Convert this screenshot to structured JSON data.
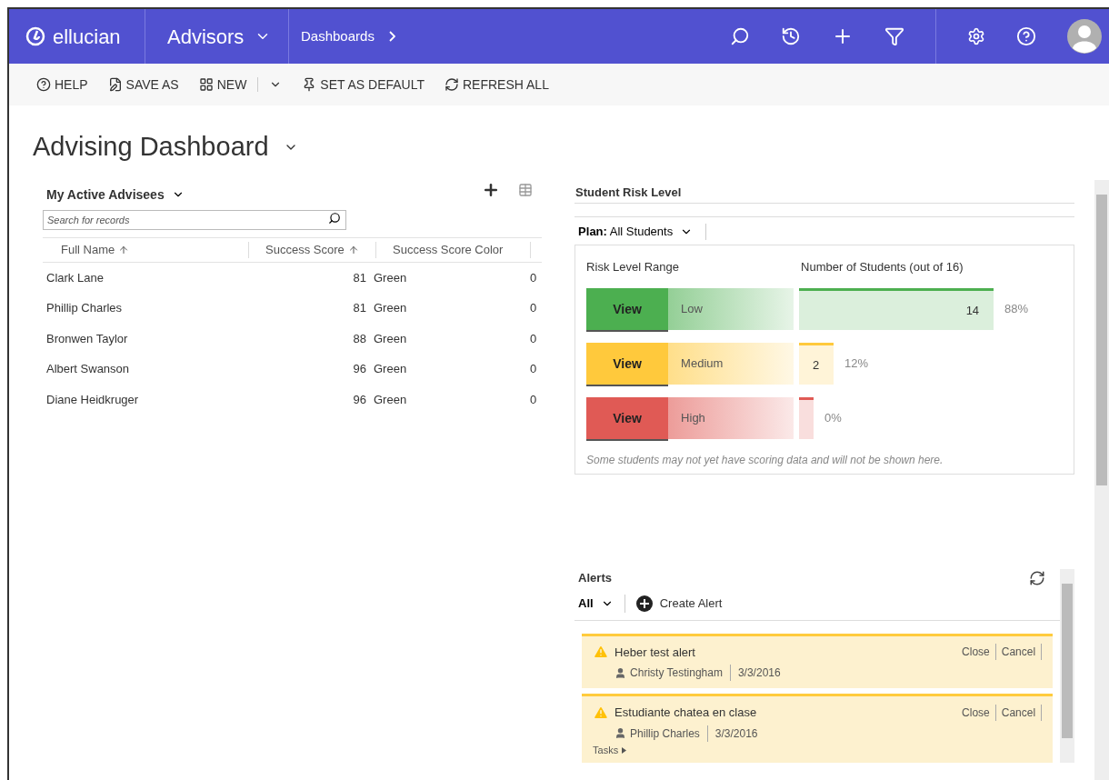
{
  "nav": {
    "brand": "ellucian",
    "module": "Advisors",
    "breadcrumb": "Dashboards"
  },
  "toolbar": [
    {
      "label": "HELP",
      "kind": "button"
    },
    {
      "label": "SAVE AS",
      "kind": "button"
    },
    {
      "label": "NEW",
      "kind": "split"
    },
    {
      "label": "SET AS DEFAULT",
      "kind": "button"
    },
    {
      "label": "REFRESH ALL",
      "kind": "button"
    }
  ],
  "page_title": "Advising Dashboard",
  "advisees": {
    "view": "My Active Advisees",
    "search": {
      "placeholder": "Search for records"
    },
    "columns": [
      {
        "label": "Full Name",
        "sorted": true
      },
      {
        "label": "Success Score",
        "sorted": true
      },
      {
        "label": "Success Score Color",
        "sorted": false
      }
    ],
    "rows": [
      {
        "name": "Clark Lane",
        "score": "81",
        "score_color": "Green",
        "column_4": "0"
      },
      {
        "name": "Phillip Charles",
        "score": "81",
        "score_color": "Green",
        "column_4": "0"
      },
      {
        "name": "Bronwen Taylor",
        "score": "88",
        "score_color": "Green",
        "column_4": "0"
      },
      {
        "name": "Albert Swanson",
        "score": "96",
        "score_color": "Green",
        "column_4": "0"
      },
      {
        "name": "Diane Heidkruger",
        "score": "96",
        "score_color": "Green",
        "column_4": "0"
      }
    ]
  },
  "risk": {
    "title": "Student Risk Level",
    "plan_label": "Plan:",
    "plan": "All Students",
    "range_header": "Risk Level Range",
    "count_header": "Number of Students (out of 16)",
    "levels": [
      {
        "button": "View",
        "label": "Low",
        "color": "#4caf50",
        "count": "14",
        "percent": "88%"
      },
      {
        "button": "View",
        "label": "Medium",
        "color": "#ffc93c",
        "count": "2",
        "percent": "12%"
      },
      {
        "button": "View",
        "label": "High",
        "color": "#e05a55",
        "percent": "0%"
      }
    ],
    "note": "Some students may not yet have scoring data and will not be shown here."
  },
  "alerts": {
    "title": "Alerts",
    "filter": "All",
    "create": "Create Alert",
    "items": [
      {
        "title": "Heber test alert",
        "person": "Christy Testingham",
        "date": "3/3/2016",
        "actions": [
          "Close",
          "Cancel"
        ]
      },
      {
        "title": "Estudiante chatea en clase",
        "person": "Phillip Charles",
        "date": "3/3/2016",
        "actions": [
          "Close",
          "Cancel"
        ],
        "tasks": "Tasks"
      }
    ]
  }
}
